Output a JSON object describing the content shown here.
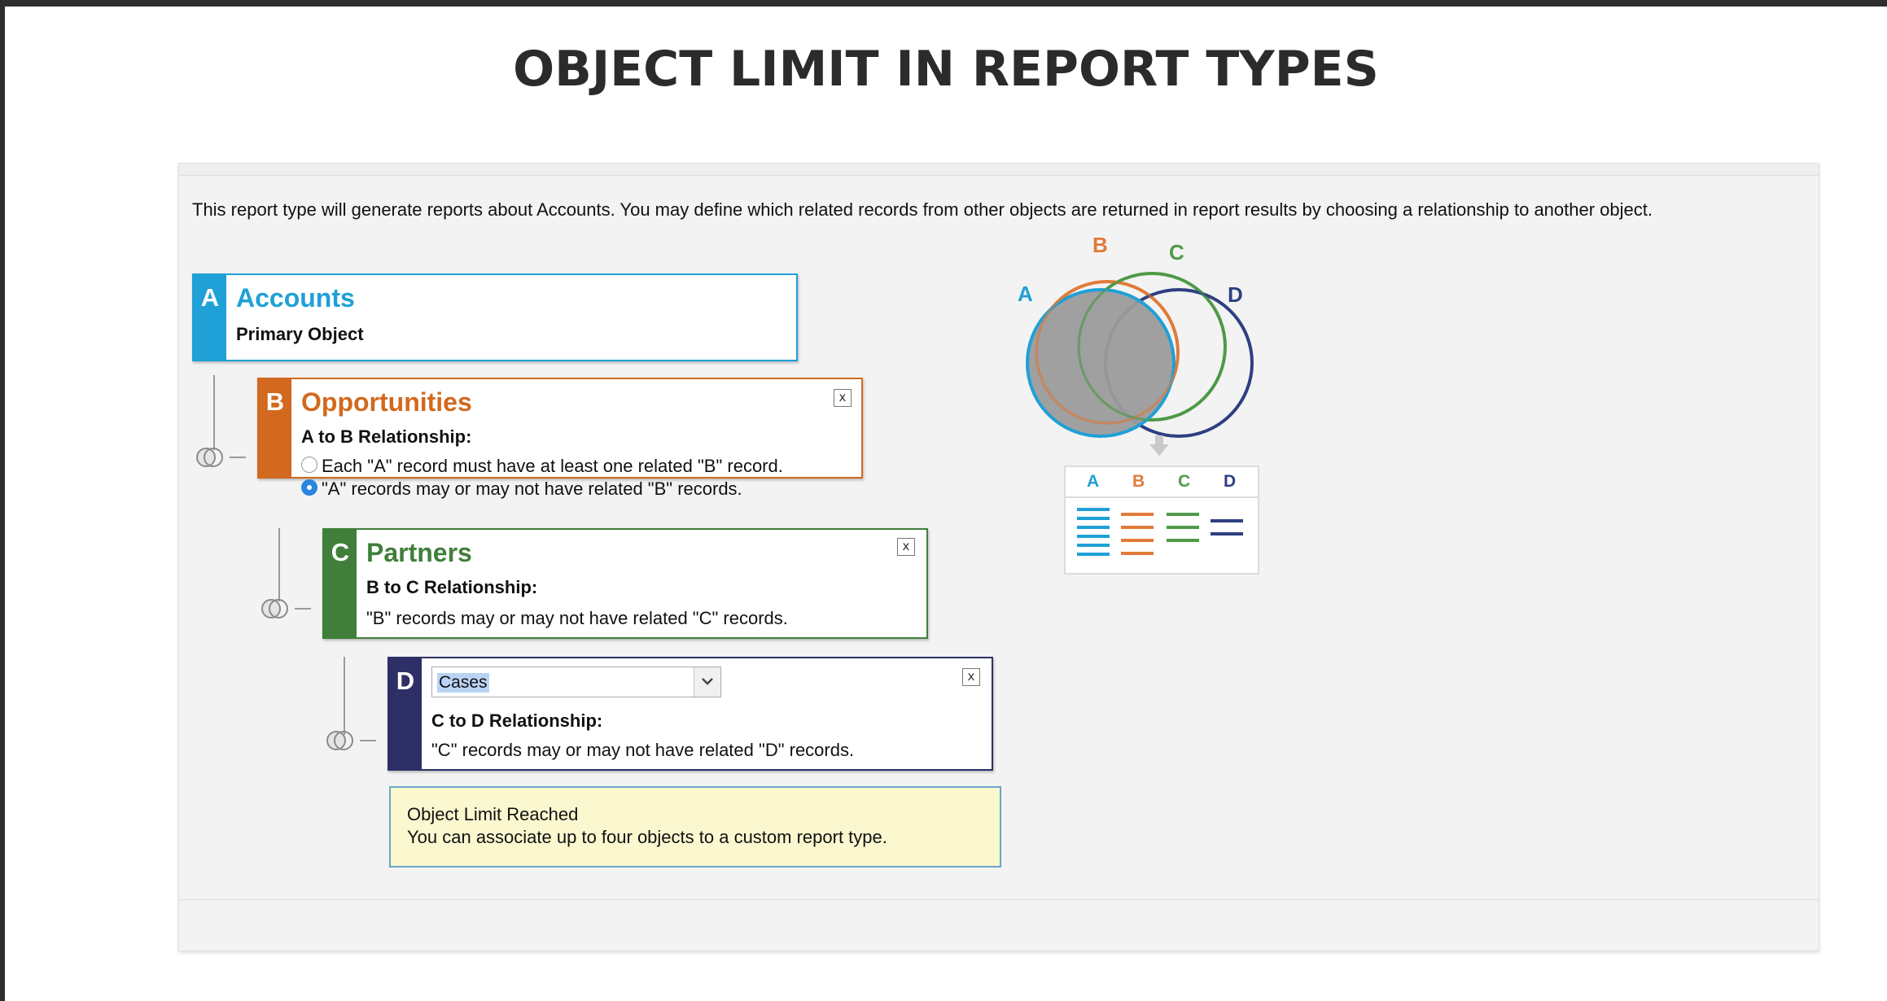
{
  "slide_title": "OBJECT LIMIT IN REPORT TYPES",
  "intro_text": "This report type will generate reports about Accounts. You may define which related records from other objects are returned in report results by choosing a relationship to another object.",
  "colors": {
    "a": "#1fa0d6",
    "b": "#d2691e",
    "c": "#3f7f3a",
    "d": "#2e2f66",
    "venn_b": "#e07b39",
    "venn_c": "#4f9a48",
    "venn_d": "#2f3f82"
  },
  "objects": {
    "a": {
      "letter": "A",
      "name": "Accounts",
      "subtitle": "Primary Object"
    },
    "b": {
      "letter": "B",
      "name": "Opportunities",
      "relationship_label": "A to B Relationship:",
      "options": [
        {
          "text": "Each \"A\" record must have at least one related \"B\" record.",
          "selected": false
        },
        {
          "text": "\"A\" records may or may not have related \"B\" records.",
          "selected": true
        }
      ],
      "close": "x"
    },
    "c": {
      "letter": "C",
      "name": "Partners",
      "relationship_label": "B to C Relationship:",
      "relationship_text": "\"B\" records may or may not have related \"C\" records.",
      "close": "x"
    },
    "d": {
      "letter": "D",
      "select_value": "Cases",
      "relationship_label": "C to D Relationship:",
      "relationship_text": "\"C\" records may or may not have related \"D\" records.",
      "close": "x"
    }
  },
  "alert": {
    "title": "Object Limit Reached",
    "body": "You can associate up to four objects to a custom report type."
  },
  "venn": {
    "labels": [
      "A",
      "B",
      "C",
      "D"
    ],
    "table_headers": [
      "A",
      "B",
      "C",
      "D"
    ],
    "table_line_counts": [
      6,
      4,
      3,
      2
    ]
  }
}
